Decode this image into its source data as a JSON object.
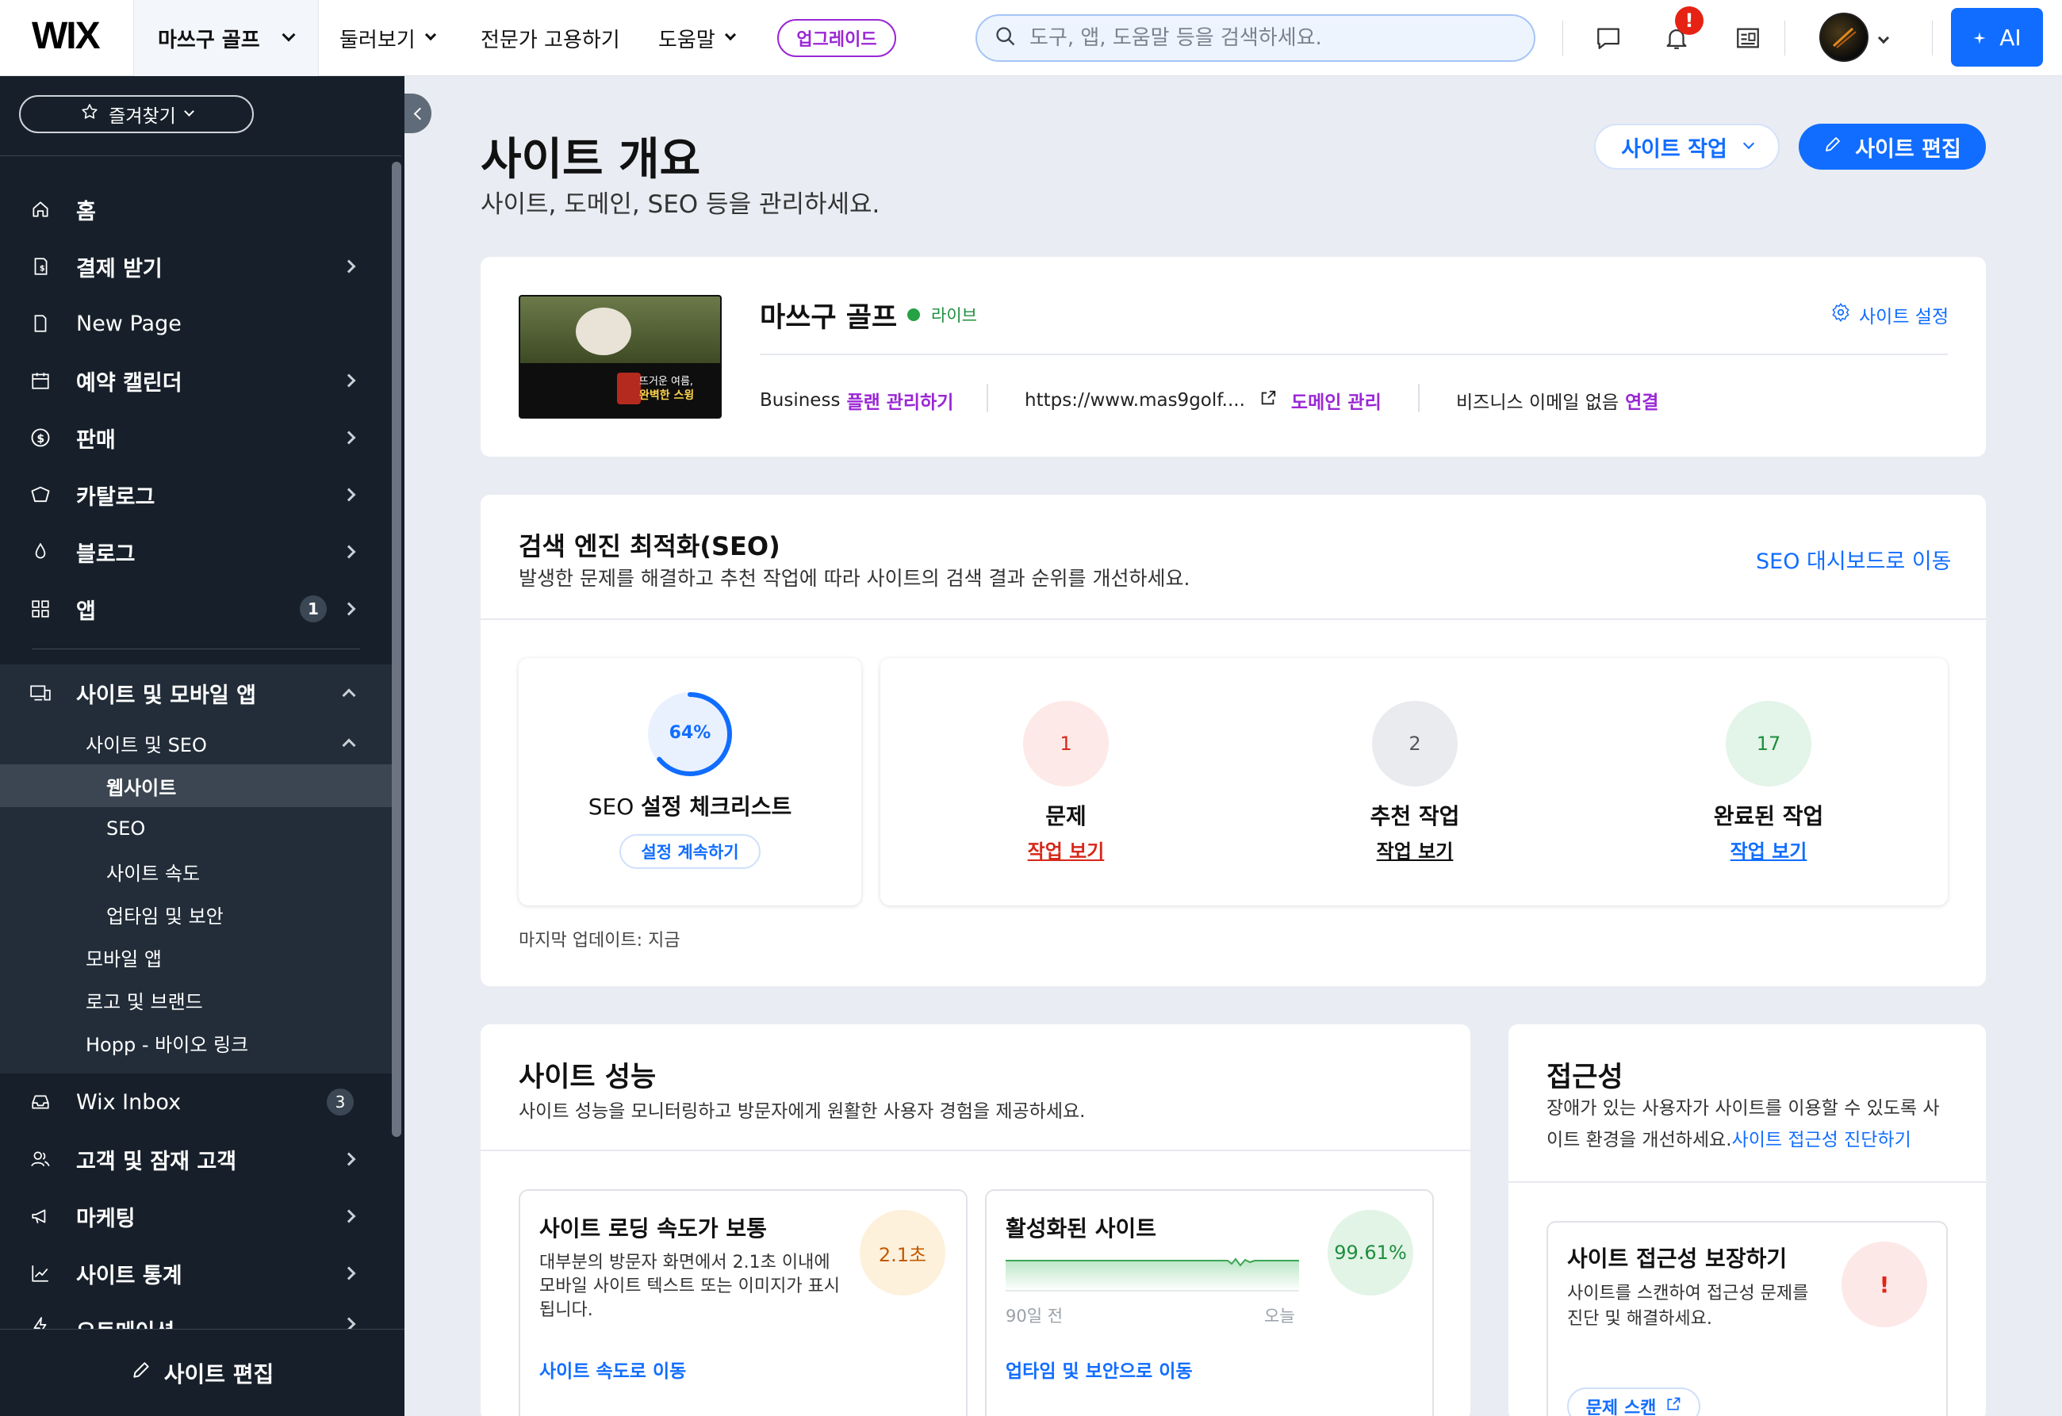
{
  "topbar": {
    "logo": "WIX",
    "site_switcher": "마쓰구 골프",
    "nav": [
      {
        "label": "둘러보기"
      },
      {
        "label": "전문가 고용하기"
      },
      {
        "label": "도움말"
      }
    ],
    "upgrade": "업그레이드",
    "search_placeholder": "도구, 앱, 도움말 등을 검색하세요.",
    "notification_badge": "!",
    "ai_label": "AI"
  },
  "sidebar": {
    "favorites": "즐겨찾기",
    "items": [
      {
        "label": "홈",
        "icon": "home-icon"
      },
      {
        "label": "결제 받기",
        "icon": "payment-icon"
      },
      {
        "label": "New Page",
        "icon": "page-icon"
      },
      {
        "label": "예약 캘린더",
        "icon": "calendar-icon"
      },
      {
        "label": "판매",
        "icon": "dollar-icon"
      },
      {
        "label": "카탈로그",
        "icon": "catalog-icon"
      },
      {
        "label": "블로그",
        "icon": "pen-nib-icon"
      },
      {
        "label": "앱",
        "icon": "apps-icon",
        "badge": "1"
      }
    ],
    "section": {
      "label": "사이트 및 모바일 앱",
      "sub_label": "사이트 및 SEO",
      "children": [
        "웹사이트",
        "SEO",
        "사이트 속도",
        "업타임 및 보안"
      ],
      "others": [
        "모바일 앱",
        "로고 및 브랜드",
        "Hopp - 바이오 링크"
      ]
    },
    "items2": [
      {
        "label": "Wix Inbox",
        "icon": "inbox-icon",
        "badge": "3"
      },
      {
        "label": "고객 및 잠재 고객",
        "icon": "people-icon"
      },
      {
        "label": "마케팅",
        "icon": "megaphone-icon"
      },
      {
        "label": "사이트 통계",
        "icon": "chart-icon"
      },
      {
        "label": "오토메이션",
        "icon": "automation-icon"
      }
    ],
    "bottom_button": "사이트 편집"
  },
  "main": {
    "title": "사이트 개요",
    "subtitle": "사이트, 도메인, SEO 등을 관리하세요.",
    "site_actions": "사이트 작업",
    "edit_site": "사이트 편집",
    "site": {
      "name": "마쓰구 골프",
      "status": "라이브",
      "settings": "사이트 설정",
      "plan": "Business",
      "plan_link": "플랜 관리하기",
      "url": "https://www.mas9golf....",
      "domain_link": "도메인 관리",
      "email": "비즈니스 이메일 없음",
      "email_link": "연결",
      "thumb_text1": "뜨거운 여름,",
      "thumb_text2": "완벽한 스윙"
    },
    "seo": {
      "title": "검색 엔진 최적화(SEO)",
      "desc": "발생한 문제를 해결하고 추천 작업에 따라 사이트의 검색 결과 순위를 개선하세요.",
      "dashboard_link": "SEO 대시보드로 이동",
      "progress": "64%",
      "progress_value": 0.64,
      "checklist_title_a": "SEO ",
      "checklist_title_b": "설정 체크리스트",
      "continue": "설정 계속하기",
      "tasks": [
        {
          "count": "1",
          "label": "문제",
          "link": "작업 보기",
          "color": "#d6281a",
          "bg": "#fde9e7"
        },
        {
          "count": "2",
          "label": "추천 작업",
          "link": "작업 보기",
          "color": "#111111",
          "bg": "#e9ebef"
        },
        {
          "count": "17",
          "label": "완료된 작업",
          "link": "작업 보기",
          "color": "#116dff",
          "bg": "#e3f4e8"
        }
      ],
      "last_update": "마지막 업데이트: 지금"
    },
    "performance": {
      "title": "사이트 성능",
      "desc": "사이트 성능을 모니터링하고 방문자에게 원활한 사용자 경험을 제공하세요.",
      "speed_title": "사이트 로딩 속도가 보통",
      "speed_desc": "대부분의 방문자 화면에서 2.1초 이내에 모바일 사이트 텍스트 또는 이미지가 표시됩니다.",
      "speed_value": "2.1초",
      "speed_link": "사이트 속도로 이동",
      "uptime_title": "활성화된 사이트",
      "uptime_value": "99.61%",
      "uptime_start": "90일 전",
      "uptime_end": "오늘",
      "uptime_link": "업타임 및 보안으로 이동"
    },
    "accessibility": {
      "title": "접근성",
      "desc": "장애가 있는 사용자가 사이트를 이용할 수 있도록 사이트 환경을 개선하세요.",
      "desc_link": "사이트 접근성 진단하기",
      "inner_title": "사이트 접근성 보장하기",
      "inner_desc": "사이트를 스캔하여 접근성 문제를 진단 및 해결하세요.",
      "indicator": "!",
      "scan_button": "문제 스캔"
    }
  }
}
